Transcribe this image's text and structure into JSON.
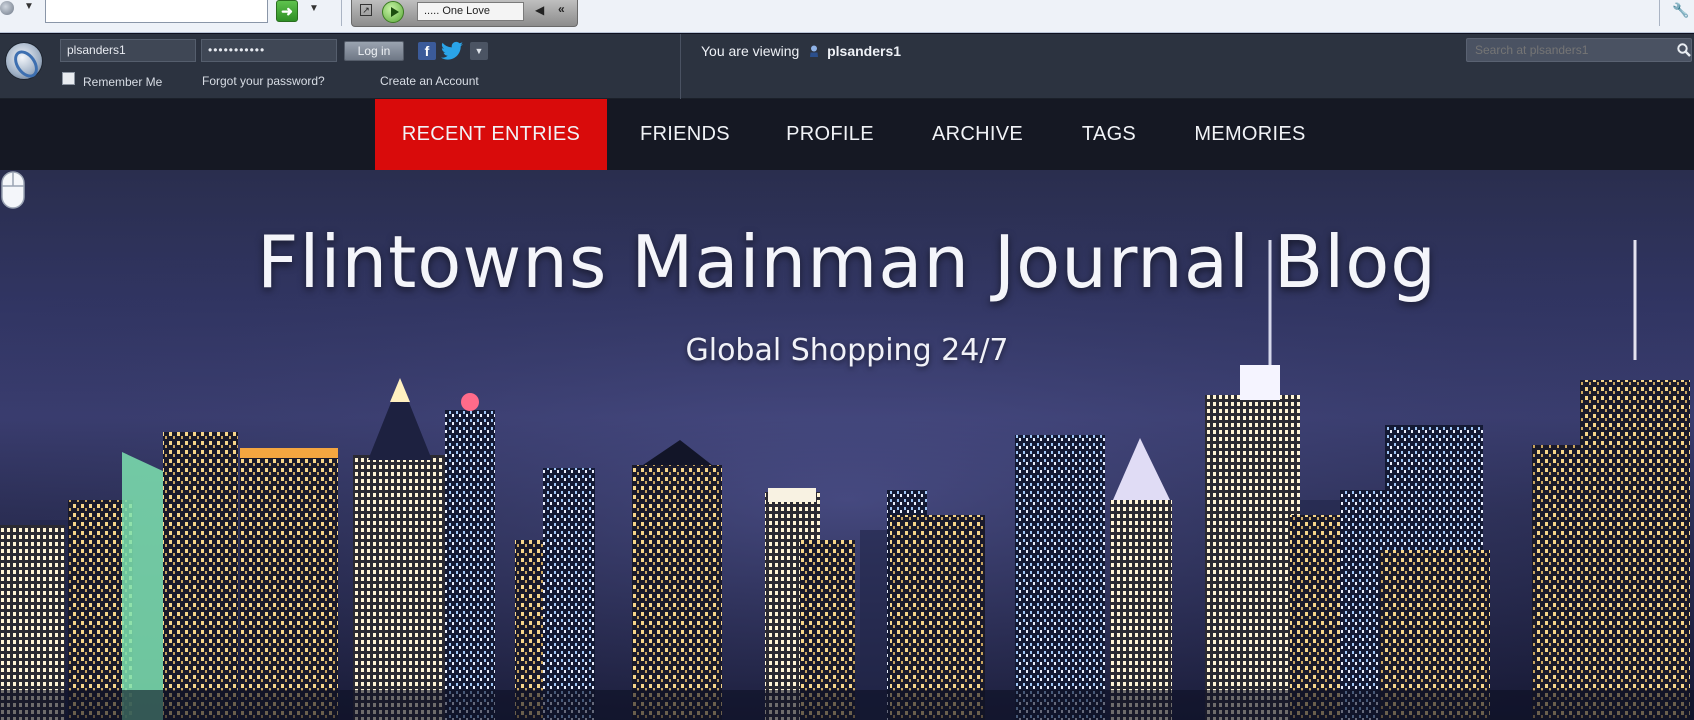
{
  "browser": {
    "address_value": "",
    "player": {
      "track": "..... One Love"
    }
  },
  "login": {
    "username": "plsanders1",
    "password_mask": "•••••••••••",
    "login_label": "Log in",
    "remember_label": "Remember Me",
    "forgot_label": "Forgot your password?",
    "create_label": "Create an Account"
  },
  "viewing": {
    "prefix": "You are viewing",
    "user": "plsanders1"
  },
  "search": {
    "placeholder": "Search at plsanders1"
  },
  "nav": {
    "items": [
      {
        "label": "RECENT ENTRIES",
        "active": true
      },
      {
        "label": "FRIENDS"
      },
      {
        "label": "PROFILE"
      },
      {
        "label": "ARCHIVE"
      },
      {
        "label": "TAGS"
      },
      {
        "label": "MEMORIES"
      }
    ]
  },
  "hero": {
    "title": "Flintowns Mainman Journal Blog",
    "subtitle": "Global Shopping 24/7"
  },
  "colors": {
    "nav_active": "#d90b0b",
    "nav_bg": "#151823",
    "login_bar_bg": "#2c3340"
  }
}
